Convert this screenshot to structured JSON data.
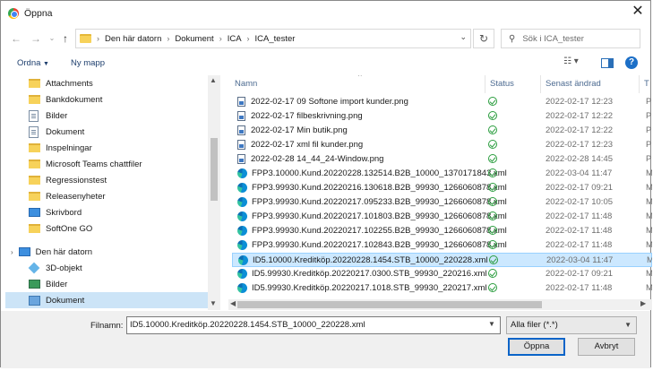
{
  "window": {
    "title": "Öppna"
  },
  "address": {
    "crumbs": [
      "Den här datorn",
      "Dokument",
      "ICA",
      "ICA_tester"
    ],
    "search_placeholder": "Sök i ICA_tester"
  },
  "toolbar": {
    "organize": "Ordna",
    "new_folder": "Ny mapp"
  },
  "nav": [
    {
      "label": "Attachments",
      "icon": "folder"
    },
    {
      "label": "Bankdokument",
      "icon": "folder"
    },
    {
      "label": "Bilder",
      "icon": "docs"
    },
    {
      "label": "Dokument",
      "icon": "docs"
    },
    {
      "label": "Inspelningar",
      "icon": "folder"
    },
    {
      "label": "Microsoft Teams chattfiler",
      "icon": "folder"
    },
    {
      "label": "Regressionstest",
      "icon": "folder"
    },
    {
      "label": "Releasenyheter",
      "icon": "folder"
    },
    {
      "label": "Skrivbord",
      "icon": "pc"
    },
    {
      "label": "SoftOne GO",
      "icon": "folder"
    },
    {
      "label": "Den här datorn",
      "icon": "pc"
    },
    {
      "label": "3D-objekt",
      "icon": "3d"
    },
    {
      "label": "Bilder",
      "icon": "pic"
    },
    {
      "label": "Dokument",
      "icon": "docblue"
    }
  ],
  "columns": {
    "name": "Namn",
    "status": "Status",
    "date": "Senast ändrad",
    "type": "T"
  },
  "files": [
    {
      "name": "2022-02-17 09 Softone import kunder.png",
      "date": "2022-02-17 12:23",
      "type": "P",
      "icon": "png"
    },
    {
      "name": "2022-02-17 filbeskrivning.png",
      "date": "2022-02-17 12:22",
      "type": "P",
      "icon": "png"
    },
    {
      "name": "2022-02-17 Min butik.png",
      "date": "2022-02-17 12:22",
      "type": "P",
      "icon": "png"
    },
    {
      "name": "2022-02-17 xml fil kunder.png",
      "date": "2022-02-17 12:23",
      "type": "P",
      "icon": "png"
    },
    {
      "name": "2022-02-28 14_44_24-Window.png",
      "date": "2022-02-28 14:45",
      "type": "P",
      "icon": "png"
    },
    {
      "name": "FPP3.10000.Kund.20220228.132514.B2B_10000_1370171843.xml",
      "date": "2022-03-04 11:47",
      "type": "M",
      "icon": "edge"
    },
    {
      "name": "FPP3.99930.Kund.20220216.130618.B2B_99930_1266060878.xml",
      "date": "2022-02-17 09:21",
      "type": "M",
      "icon": "edge"
    },
    {
      "name": "FPP3.99930.Kund.20220217.095233.B2B_99930_1266060878.xml",
      "date": "2022-02-17 10:05",
      "type": "M",
      "icon": "edge"
    },
    {
      "name": "FPP3.99930.Kund.20220217.101803.B2B_99930_1266060878.xml",
      "date": "2022-02-17 11:48",
      "type": "M",
      "icon": "edge"
    },
    {
      "name": "FPP3.99930.Kund.20220217.102255.B2B_99930_1266060878.xml",
      "date": "2022-02-17 11:48",
      "type": "M",
      "icon": "edge"
    },
    {
      "name": "FPP3.99930.Kund.20220217.102843.B2B_99930_1266060878.xml",
      "date": "2022-02-17 11:48",
      "type": "M",
      "icon": "edge"
    },
    {
      "name": "ID5.10000.Kreditköp.20220228.1454.STB_10000_220228.xml",
      "date": "2022-03-04 11:47",
      "type": "M",
      "icon": "edge",
      "selected": true
    },
    {
      "name": "ID5.99930.Kreditköp.20220217.0300.STB_99930_220216.xml",
      "date": "2022-02-17 09:21",
      "type": "M",
      "icon": "edge"
    },
    {
      "name": "ID5.99930.Kreditköp.20220217.1018.STB_99930_220217.xml",
      "date": "2022-02-17 11:48",
      "type": "M",
      "icon": "edge"
    }
  ],
  "bottom": {
    "filename_label": "Filnamn:",
    "filename_value": "ID5.10000.Kreditköp.20220228.1454.STB_10000_220228.xml",
    "filetype": "Alla filer (*.*)",
    "open": "Öppna",
    "cancel": "Avbryt"
  }
}
